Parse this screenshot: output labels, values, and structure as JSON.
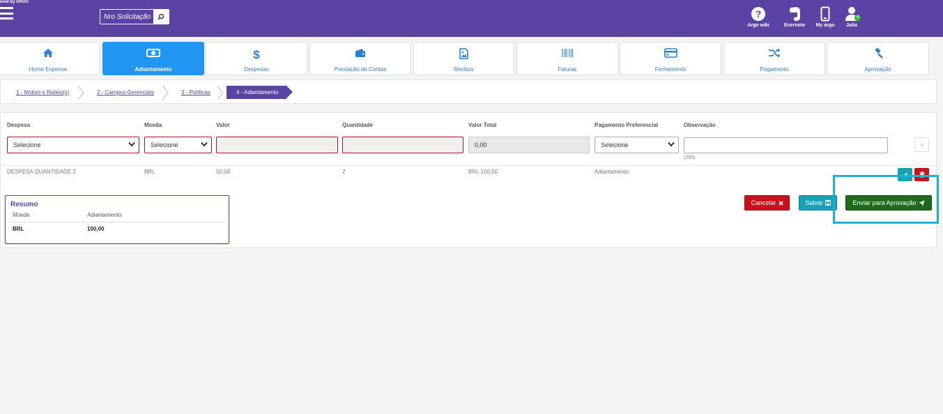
{
  "topbar": {
    "powered_text": "ered by ARGO",
    "search_placeholder": "Nro Solicitação",
    "icons": [
      {
        "label": "Argo wiki",
        "icon": "question-circle-icon"
      },
      {
        "label": "Evernote",
        "icon": "evernote-icon"
      },
      {
        "label": "My argo",
        "icon": "mobile-phone-icon"
      },
      {
        "label": "Julia",
        "icon": "user-icon",
        "badge": "4"
      }
    ]
  },
  "tabs": [
    {
      "label": "Home Expense",
      "icon": "home-icon"
    },
    {
      "label": "Adiantamento",
      "icon": "money-icon",
      "active": true
    },
    {
      "label": "Despesas",
      "icon": "dollar-icon"
    },
    {
      "label": "Prestação de Contas",
      "icon": "wallet-icon"
    },
    {
      "label": "Recibos",
      "icon": "image-file-icon"
    },
    {
      "label": "Faturas",
      "icon": "barcode-icon"
    },
    {
      "label": "Fechamento",
      "icon": "credit-card-icon"
    },
    {
      "label": "Pagamento",
      "icon": "shuffle-icon"
    },
    {
      "label": "Aprovação",
      "icon": "gavel-icon"
    }
  ],
  "breadcrumb": [
    "1 - Motivo e Rateio(s)",
    "2 - Campos Gerenciais",
    "3 - Políticas",
    "4 - Adiantamento"
  ],
  "form": {
    "headers": {
      "despesa": "Despesa",
      "moeda": "Moeda",
      "valor": "Valor",
      "quantidade": "Quantidade",
      "valor_total": "Valor Total",
      "pagamento": "Pagamento Preferencial",
      "observacao": "Observação"
    },
    "despesa_value": "Selecione",
    "moeda_value": "Selecione",
    "valor_value": "",
    "quantidade_value": "",
    "valor_total_value": "0,00",
    "pagamento_value": "Selecione",
    "observacao_value": "",
    "char_count": "(255)",
    "add_symbol": "+"
  },
  "row": {
    "despesa": "DESPESA QUANTIDADE 2",
    "moeda": "BRL",
    "valor": "50,00",
    "quantidade": "2",
    "valor_total": "BRL 100,00",
    "pagamento": "Adiantamento"
  },
  "resumo": {
    "title": "Resumo",
    "col_moeda": "Moeda",
    "col_adiantamento": "Adiantamento",
    "moeda": "BRL",
    "valor": "100,00"
  },
  "actions": {
    "cancel": "Cancelar",
    "save": "Salvar",
    "send": "Enviar para Aprovação"
  },
  "colors": {
    "brand_purple": "#5b43a3",
    "active_tab": "#2196f3",
    "danger": "#c9111e",
    "info": "#17a2b8",
    "success": "#1e6b1e",
    "highlight": "#1eb2d2"
  }
}
